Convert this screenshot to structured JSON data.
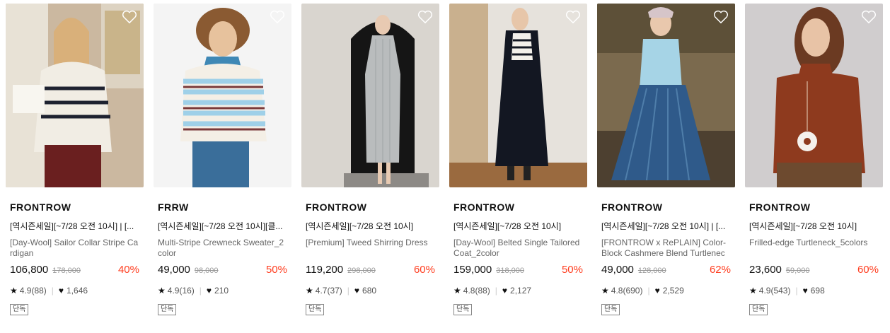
{
  "products": [
    {
      "brand": "FRONTROW",
      "promo": "[역시즌세일][~7/28 오전 10시] | [...",
      "name": "[Day-Wool] Sailor Collar Stripe Cardigan",
      "price": "106,800",
      "original_price": "178,000",
      "discount": "40%",
      "rating": "4.9(88)",
      "likes": "1,646",
      "badge": "단독",
      "image": {
        "bg": "#cbb8a0",
        "accent": "#f1ede4",
        "detail": "#1e2230",
        "lower": "#6a1f1f"
      }
    },
    {
      "brand": "FRRW",
      "promo": "[역시즌세일][~7/28 오전 10시][클...",
      "name": "Multi-Stripe Crewneck Sweater_2color",
      "price": "49,000",
      "original_price": "98,000",
      "discount": "50%",
      "rating": "4.9(16)",
      "likes": "210",
      "badge": "단독",
      "image": {
        "bg": "#f4f4f4",
        "accent": "#9fd0e8",
        "detail": "#7a3a3a",
        "lower": "#3a6e9a"
      }
    },
    {
      "brand": "FRONTROW",
      "promo": "[역시즌세일][~7/28 오전 10시]",
      "name": "[Premium] Tweed Shirring Dress",
      "price": "119,200",
      "original_price": "298,000",
      "discount": "60%",
      "rating": "4.7(37)",
      "likes": "680",
      "badge": "단독",
      "image": {
        "bg": "#d9d5cf",
        "accent": "#b9bcbd",
        "detail": "#151515",
        "lower": "#8d8a86"
      }
    },
    {
      "brand": "FRONTROW",
      "promo": "[역시즌세일][~7/28 오전 10시]",
      "name": "[Day-Wool] Belted Single Tailored Coat_2color",
      "price": "159,000",
      "original_price": "318,000",
      "discount": "50%",
      "rating": "4.8(88)",
      "likes": "2,127",
      "badge": "단독",
      "image": {
        "bg": "#e6e2dc",
        "accent": "#131722",
        "detail": "#f3f0ea",
        "lower": "#9a6a3f"
      }
    },
    {
      "brand": "FRONTROW",
      "promo": "[역시즌세일][~7/28 오전 10시] | [...",
      "name": "[FRONTROW x RePLAIN] Color-Block Cashmere Blend Turtleneck...",
      "price": "49,000",
      "original_price": "128,000",
      "discount": "62%",
      "rating": "4.8(690)",
      "likes": "2,529",
      "badge": "단독",
      "image": {
        "bg": "#7b6a4e",
        "accent": "#a6d4e6",
        "detail": "#2f5a8a",
        "lower": "#4d4030"
      }
    },
    {
      "brand": "FRONTROW",
      "promo": "[역시즌세일][~7/28 오전 10시]",
      "name": "Frilled-edge Turtleneck_5colors",
      "price": "23,600",
      "original_price": "59,000",
      "discount": "60%",
      "rating": "4.9(543)",
      "likes": "698",
      "badge": "단독",
      "image": {
        "bg": "#d0cdce",
        "accent": "#8e3a1e",
        "detail": "#f5f1ec",
        "lower": "#6d4a2f"
      }
    }
  ]
}
